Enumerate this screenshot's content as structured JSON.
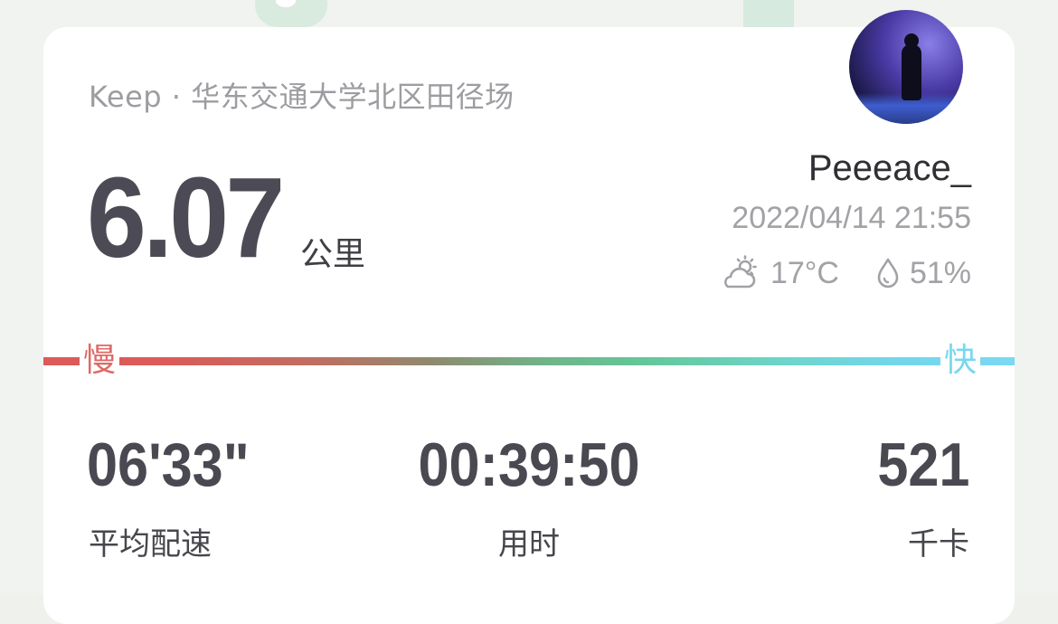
{
  "header": {
    "source": "Keep · 华东交通大学北区田径场"
  },
  "distance": {
    "value": "6.07",
    "unit": "公里"
  },
  "user": {
    "name": "Peeeace_",
    "datetime": "2022/04/14 21:55"
  },
  "weather": {
    "icon": "partly-cloudy-icon",
    "temperature": "17°C",
    "humidity_icon": "droplet-icon",
    "humidity": "51%"
  },
  "pace_scale": {
    "slow_label": "慢",
    "fast_label": "快",
    "colors": {
      "slow": "#dc5a58",
      "mid": "#63c79a",
      "fast": "#7ad9f2"
    }
  },
  "stats": [
    {
      "value": "06'33\"",
      "label": "平均配速"
    },
    {
      "value": "00:39:50",
      "label": "用时"
    },
    {
      "value": "521",
      "label": "千卡"
    }
  ]
}
